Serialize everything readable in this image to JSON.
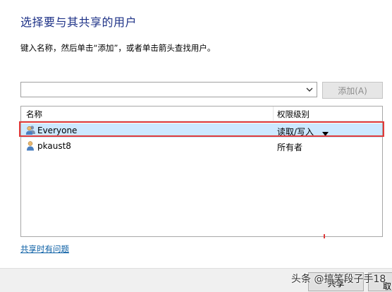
{
  "dialog": {
    "title": "选择要与其共享的用户",
    "instruction": "键入名称，然后单击“添加”，或者单击箭头查找用户。",
    "combo_value": "",
    "add_button": "添加(A)",
    "problems_link": "共享时有问题",
    "share_button": "共享",
    "cancel_button": "取"
  },
  "table": {
    "headers": {
      "name": "名称",
      "permission": "权限级别"
    },
    "rows": [
      {
        "name": "Everyone",
        "permission": "读取/写入",
        "icon": "user-group-icon",
        "selected": true
      },
      {
        "name": "pkaust8",
        "permission": "所有者",
        "icon": "user-icon",
        "selected": false
      }
    ]
  },
  "watermark": "头条 @搞笑段子手18",
  "colors": {
    "title": "#1e3287",
    "selection": "#cce8ff",
    "highlight": "#e03a3a",
    "link": "#0b5fa5"
  }
}
